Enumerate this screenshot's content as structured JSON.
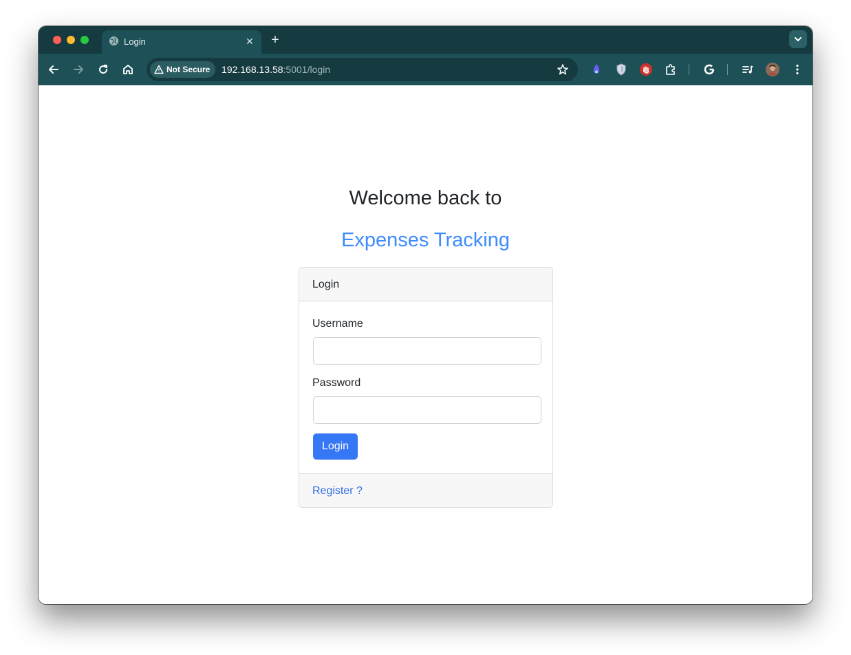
{
  "browser": {
    "tab_title": "Login",
    "new_tab_label": "+",
    "close_tab_label": "✕",
    "security_label": "Not Secure",
    "url_host": "192.168.13.58",
    "url_rest": ":5001/login"
  },
  "page": {
    "welcome": "Welcome back to",
    "brand": "Expenses Tracking",
    "card_header": "Login",
    "username_label": "Username",
    "password_label": "Password",
    "username_value": "",
    "password_value": "",
    "login_button": "Login",
    "register_link": "Register ?"
  },
  "colors": {
    "tabstrip": "#153a40",
    "toolbar": "#1e5157",
    "brand": "#3d8bfd",
    "primary_button": "#3677f6",
    "link": "#2f6ee6"
  },
  "icons": [
    "globe-icon",
    "close-icon",
    "plus-icon",
    "chevron-down-icon",
    "back-icon",
    "forward-icon",
    "reload-icon",
    "home-icon",
    "warning-icon",
    "star-icon",
    "extension-flame-icon",
    "shield-icon",
    "stop-hand-icon",
    "puzzle-icon",
    "google-icon",
    "media-queue-icon",
    "avatar",
    "more-vert-icon"
  ]
}
